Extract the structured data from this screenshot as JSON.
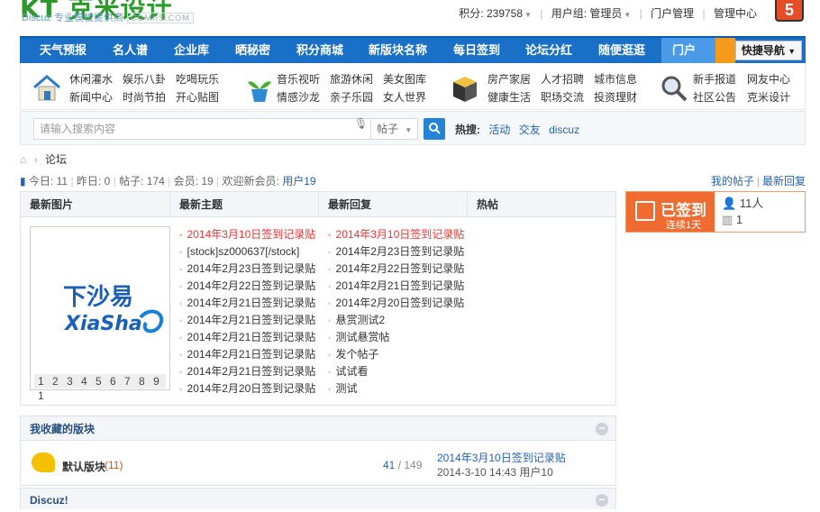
{
  "site": {
    "logo_text": "KT 克米设计",
    "subtitle": "Discuz 专业模板提供商",
    "subtitle_tag": "COMIIS.COM",
    "html5_badge": "5"
  },
  "user": {
    "points": "积分: 239758",
    "group": "用户组: 管理员",
    "portal_admin": "门户管理",
    "admin_center": "管理中心"
  },
  "nav": {
    "items": [
      "天气预报",
      "名人谱",
      "企业库",
      "晒秘密",
      "积分商城",
      "新版块名称",
      "每日签到",
      "论坛分红",
      "随便逛逛",
      "门户"
    ],
    "fast_nav": "快捷导航"
  },
  "quick": {
    "g1": [
      "休闲灌水",
      "娱乐八卦",
      "吃喝玩乐",
      "新闻中心",
      "时尚节拍",
      "开心贴图"
    ],
    "g2": [
      "音乐视听",
      "旅游休闲",
      "美女图库",
      "情感沙龙",
      "亲子乐园",
      "女人世界"
    ],
    "g3": [
      "房产家居",
      "人才招聘",
      "城市信息",
      "健康生活",
      "职场交流",
      "投资理财"
    ],
    "g4": [
      "新手报道",
      "网友中心",
      "社区公告",
      "克米设计"
    ]
  },
  "search": {
    "placeholder": "请输入搜索内容",
    "scope": "帖子",
    "hot_label": "热搜:",
    "hot": [
      "活动",
      "交友",
      "discuz"
    ]
  },
  "breadcrumb": {
    "current": "论坛"
  },
  "stats": {
    "today_label": "今日:",
    "today": "11",
    "yesterday_label": "昨日:",
    "yesterday": "0",
    "posts_label": "帖子:",
    "posts": "174",
    "members_label": "会员:",
    "members": "19",
    "welcome": "欢迎新会员:",
    "newest": "用户19",
    "my_posts": "我的帖子",
    "new_replies": "最新回复"
  },
  "tabs": [
    "最新图片",
    "最新主题",
    "最新回复",
    "热帖"
  ],
  "slideshow": {
    "brand_cn": "下沙易",
    "brand_en": "XiaSha",
    "pages": "1 2 3 4 5 6 7 8 9 1"
  },
  "new_threads": [
    "2014年3月10日签到记录贴",
    "[stock]sz000637[/stock]",
    "2014年2月23日签到记录贴",
    "2014年2月22日签到记录贴",
    "2014年2月21日签到记录贴",
    "2014年2月21日签到记录贴",
    "2014年2月21日签到记录贴",
    "2014年2月21日签到记录贴",
    "2014年2月21日签到记录贴",
    "2014年2月20日签到记录贴"
  ],
  "new_replies": [
    "2014年3月10日签到记录贴",
    "2014年2月23日签到记录贴",
    "2014年2月22日签到记录贴",
    "2014年2月21日签到记录贴",
    "2014年2月20日签到记录贴",
    "悬赏测试2",
    "测试悬赏帖",
    "发个帖子",
    "试试看",
    "测试"
  ],
  "sign": {
    "status": "已签到",
    "streak": "连续1天",
    "people": "11人",
    "rank": "1"
  },
  "favorites": {
    "title": "我收藏的版块",
    "forum_name": "默认版块",
    "forum_today": "(11)",
    "threads": "41",
    "posts": "/ 149",
    "last_title": "2014年3月10日签到记录贴",
    "last_meta": "2014-3-10 14:43 用户10"
  },
  "discuz_section": {
    "title": "Discuz!"
  },
  "colors": {
    "nav_blue": "#1a6fc6",
    "accent_orange": "#f06b2f",
    "link_blue": "#2563b0"
  }
}
